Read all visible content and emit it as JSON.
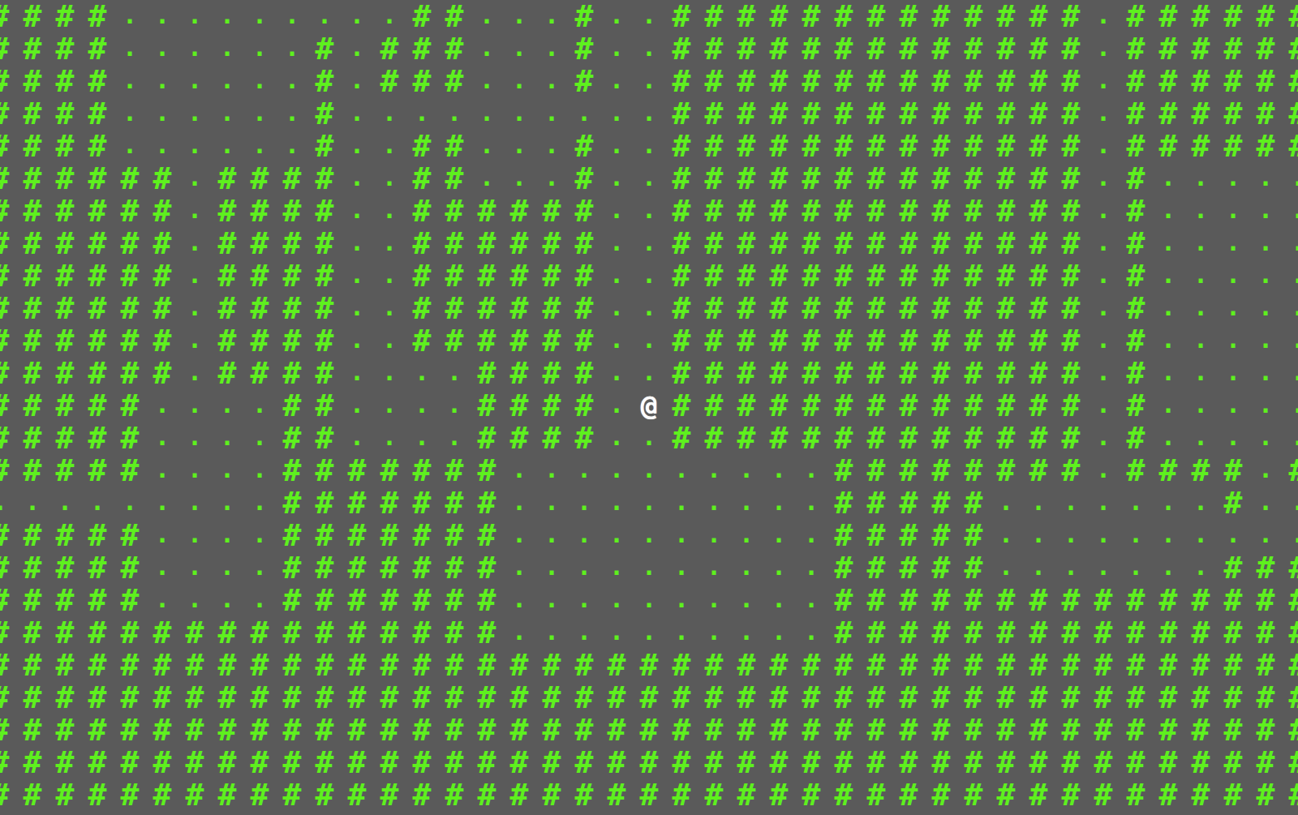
{
  "map": {
    "rows": [
      "####.........##...#..#############.######",
      "####......#.###...#..#############.######",
      "####......#.###...#..#############.######",
      "####......#..........#############.######",
      "####......#..##...#..#############.######",
      "######.####..##...#..#############.#.....",
      "######.####..######..#############.#.....",
      "######.####..######..#############.#.....",
      "######.####..######..#############.#.....",
      "######.####..######..#############.#.....",
      "######.####..######..#############.#.....",
      "######.####....####..#############.#.....",
      "#####....##....####.@#############.#.....",
      "#####....##....####..#############.#.....",
      "#####....#######..........########.####.#",
      ".........#######..........#####.......#..",
      "#####....#######..........#####..........",
      "#####....#######..........#####.......###",
      "#####....#######..........###############",
      "################..........###############",
      "#########################################",
      "#########################################",
      "#########################################",
      "#########################################",
      "#########################################"
    ]
  }
}
